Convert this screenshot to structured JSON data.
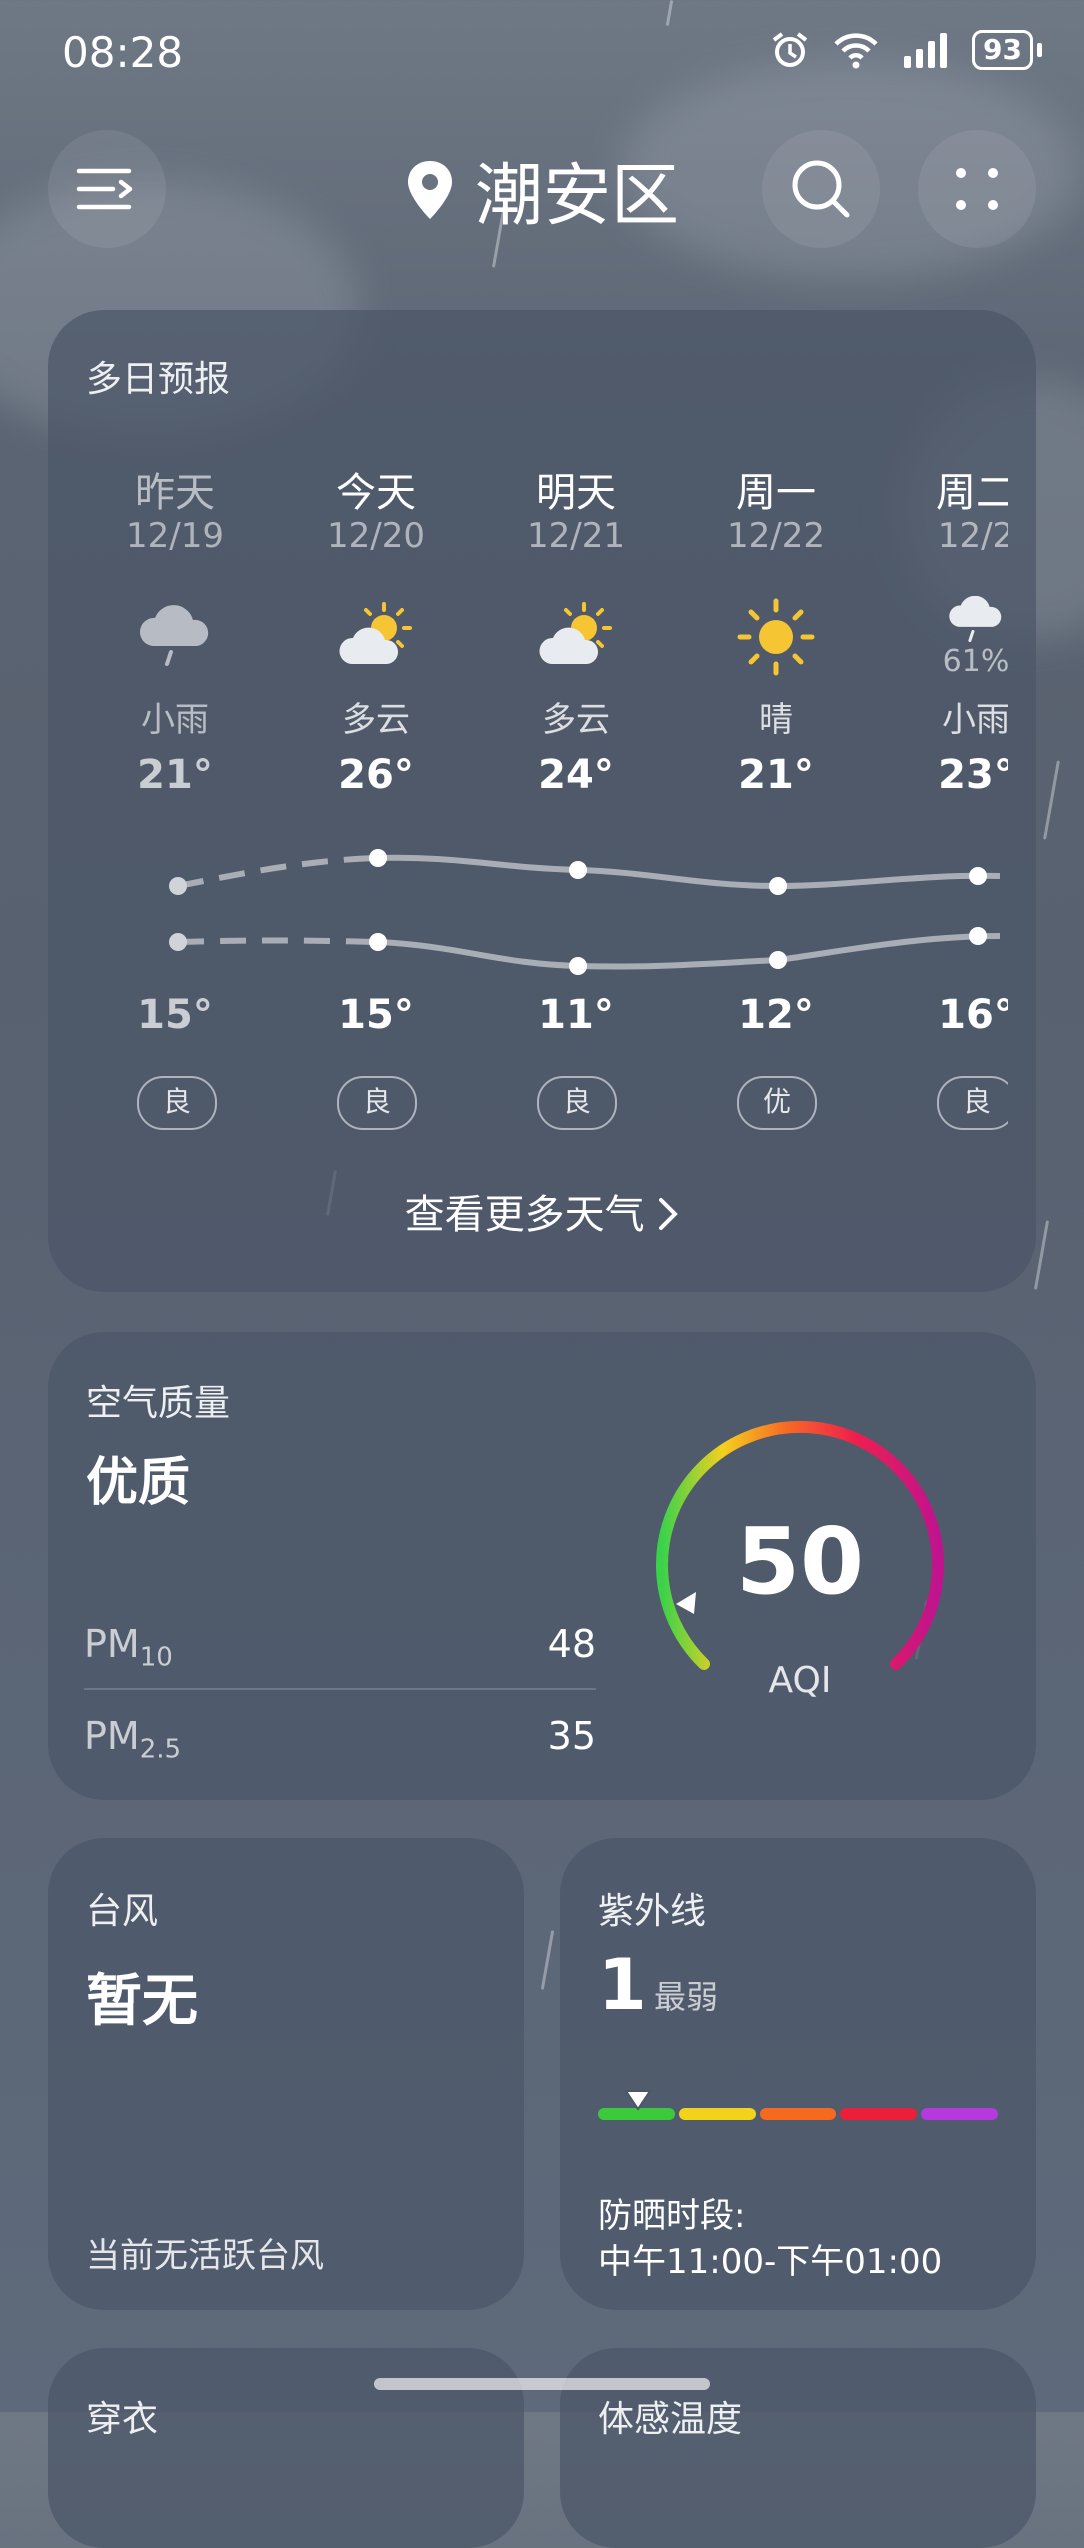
{
  "status_bar": {
    "time": "08:28",
    "battery": "93",
    "icons": [
      "alarm-icon",
      "wifi-icon",
      "signal-icon",
      "battery-icon"
    ]
  },
  "header": {
    "location": "潮安区",
    "icons": [
      "menu-icon",
      "location-pin-icon",
      "search-icon",
      "more-icon"
    ]
  },
  "forecast": {
    "title": "多日预报",
    "days": [
      {
        "day": "昨天",
        "date": "12/19",
        "icon": "light-rain-icon",
        "desc": "小雨",
        "high": "21°",
        "low": "15°",
        "aqi": "良"
      },
      {
        "day": "今天",
        "date": "12/20",
        "icon": "partly-cloudy-icon",
        "desc": "多云",
        "high": "26°",
        "low": "15°",
        "aqi": "良"
      },
      {
        "day": "明天",
        "date": "12/21",
        "icon": "partly-cloudy-icon",
        "desc": "多云",
        "high": "24°",
        "low": "11°",
        "aqi": "良"
      },
      {
        "day": "周一",
        "date": "12/22",
        "icon": "sunny-icon",
        "desc": "晴",
        "high": "21°",
        "low": "12°",
        "aqi": "优"
      },
      {
        "day": "周二",
        "date": "12/2",
        "icon": "light-rain-icon",
        "precip": "61%",
        "desc": "小雨",
        "high": "23°",
        "low": "16°",
        "aqi": "良"
      }
    ],
    "more_link": "查看更多天气"
  },
  "air_quality": {
    "title": "空气质量",
    "level": "优质",
    "aqi_value": "50",
    "aqi_label": "AQI",
    "aqi_fraction": 0.1,
    "pm10": {
      "label": "PM",
      "sub": "10",
      "value": "48"
    },
    "pm25": {
      "label": "PM",
      "sub": "2.5",
      "value": "35"
    }
  },
  "typhoon": {
    "title": "台风",
    "status": "暂无",
    "note": "当前无活跃台风"
  },
  "uv": {
    "title": "紫外线",
    "index": "1",
    "level": "最弱",
    "level_fraction": 0.1,
    "scale_colors": [
      "#3cc93c",
      "#f2d21a",
      "#f56a1e",
      "#ec1f3a",
      "#b43ae0"
    ],
    "protection_label": "防晒时段:",
    "protection_time": "中午11:00-下午01:00"
  },
  "bottom_cards": {
    "left_title": "穿衣",
    "right_title": "体感温度"
  },
  "colors": {
    "card_bg": "#4b5668",
    "accent_curve": "#a9aeb6"
  }
}
